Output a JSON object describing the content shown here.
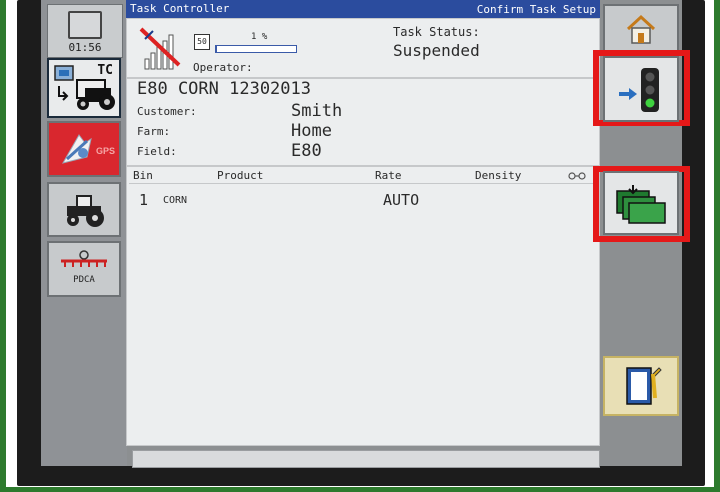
{
  "clock": {
    "time": "01:56"
  },
  "left_tiles": {
    "tc_label": "TC",
    "gps_label": "GPS",
    "pdca_label": "PDCA"
  },
  "header": {
    "title": "Task Controller",
    "action": "Confirm Task Setup"
  },
  "status": {
    "battery_value": "50",
    "progress_label": "1 %",
    "progress_fraction": 0.01,
    "operator_label": "Operator:",
    "task_status_label": "Task Status:",
    "task_status_value": "Suspended"
  },
  "task": {
    "name": "E80 CORN 12302013",
    "customer_label": "Customer:",
    "customer_value": "Smith",
    "farm_label": "Farm:",
    "farm_value": "Home",
    "field_label": "Field:",
    "field_value": "E80"
  },
  "table": {
    "headers": {
      "bin": "Bin",
      "product": "Product",
      "rate": "Rate",
      "density": "Density"
    },
    "rows": [
      {
        "bin": "1",
        "product": "CORN",
        "rate": "AUTO",
        "density": ""
      }
    ]
  },
  "colors": {
    "header_blue": "#2b4c9e",
    "highlight_red": "#e51818",
    "bezel_green": "#2d7a2d"
  }
}
